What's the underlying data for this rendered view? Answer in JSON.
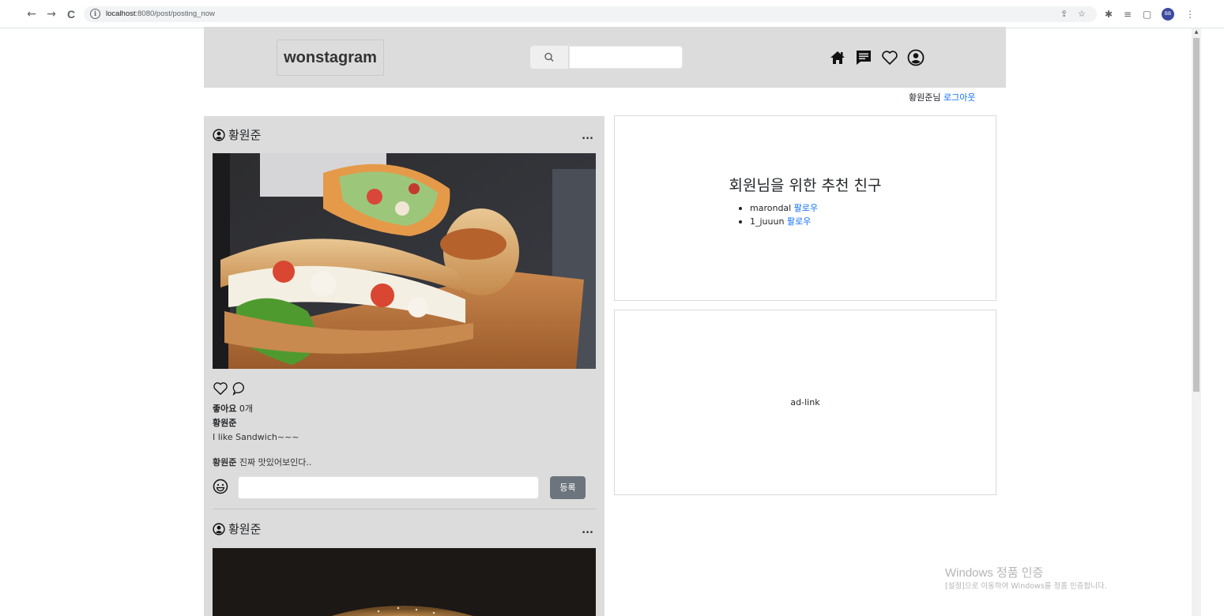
{
  "browser": {
    "url_host": "localhost",
    "url_rest": ":8080/post/posting_now",
    "back": "←",
    "forward": "→",
    "reload": "C",
    "profile_initials": "BB"
  },
  "header": {
    "logo": "wonstagram",
    "search_placeholder": "",
    "icons": [
      "home-icon",
      "message-icon",
      "heart-icon",
      "profile-icon"
    ]
  },
  "session": {
    "greeting": "황원준님",
    "logout_label": "로그아웃"
  },
  "feed": {
    "posts": [
      {
        "username": "황원준",
        "more": "...",
        "likes_label": "좋아요",
        "likes_count": "0개",
        "author": "황원준",
        "caption": "I like Sandwich~~~",
        "comment_author": "황원준",
        "comment_text": "진짜 맛있어보인다..",
        "comment_placeholder": "",
        "submit_label": "등록"
      },
      {
        "username": "황원준",
        "more": "..."
      }
    ]
  },
  "recommend": {
    "title": "회원님을 위한 추천 친구",
    "items": [
      {
        "name": "marondal",
        "action": "팔로우"
      },
      {
        "name": "1_juuun",
        "action": "팔로우"
      }
    ]
  },
  "ad": {
    "text": "ad-link"
  },
  "watermark": {
    "line1": "Windows 정품 인증",
    "line2": "[설정]으로 이동하여 Windows를 정품 인증합니다."
  },
  "colors": {
    "header_bg": "#dcdcdc",
    "link": "#0d6efd",
    "submit_bg": "#6c757d"
  }
}
